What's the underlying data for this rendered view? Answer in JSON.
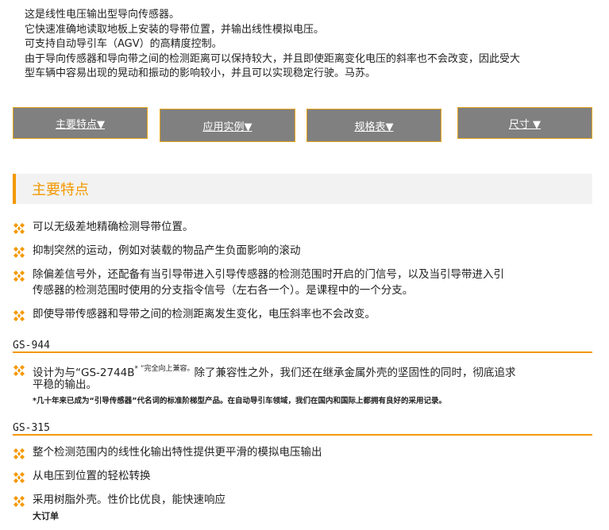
{
  "intro": [
    "这是线性电压输出型导向传感器。",
    "它快速准确地读取地板上安装的导带位置，并输出线性模拟电压。",
    "可支持自动导引车（AGV）的高精度控制。",
    "由于导向传感器和导向带之间的检测距离可以保持较大，并且即使距离变化电压的斜率也不会改变，因此受大",
    "型车辆中容易出现的晃动和振动的影响较小，并且可以实现稳定行驶。马苏。"
  ],
  "tabs": [
    {
      "label": "主要特点▼"
    },
    {
      "label": "应用实例▼"
    },
    {
      "label": "规格表▼"
    },
    {
      "label": "尺寸 ▼"
    }
  ],
  "section_title": "主要特点",
  "features": [
    "可以无级差地精确检测导带位置。",
    "抑制突然的运动，例如对装载的物品产生负面影响的滚动",
    "除偏差信号外，还配备有当引导带进入引导传感器的检测范围时开启的门信号，以及当引导带进入引",
    "传感器的检测范围时使用的分支指令信号（左右各一个）。是课程中的一个分支。",
    "即使导带传感器和导带之间的检测距离发生变化，电压斜率也不会改变。"
  ],
  "gs944": {
    "model": "GS-944",
    "line1_a": "设计为与“GS-2744B",
    "line1_sup": "* ”完全向上兼容。",
    "line1_b": "除了兼容性之外，我们还在继承金属外壳的坚固性的同时，彻底追求",
    "line2": "平稳的输出。",
    "note": "*几十年来已成为“引导传感器”代名词的标准阶梯型产品。在自动导引车领域，我们在国内和国际上都拥有良好的采用记录。"
  },
  "gs315": {
    "model": "GS-315",
    "items": [
      "整个检测范围内的线性化输出特性提供更平滑的模拟电压输出",
      "从电压到位置的轻松转换",
      "采用树脂外壳。性价比优良，能快速响应"
    ],
    "tail": "大订单"
  },
  "colors": {
    "accent": "#f39800",
    "tab_bg": "#808080",
    "tab_border": "#e8a419",
    "section_bg": "#f2f2f2"
  },
  "icon": "orange-diamond-cluster-icon"
}
